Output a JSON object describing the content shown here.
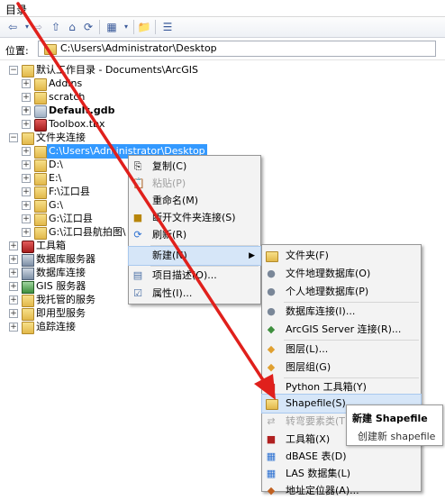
{
  "window": {
    "title": "目录"
  },
  "location": {
    "label": "位置:",
    "value": "C:\\Users\\Administrator\\Desktop"
  },
  "tree": {
    "home": "默认工作目录 - Documents\\ArcGIS",
    "addins": "AddIns",
    "scratch": "scratch",
    "default_gdb": "Default.gdb",
    "toolbox": "Toolbox.tbx",
    "folder_connections": "文件夹连接",
    "desktop": "C:\\Users\\Administrator\\Desktop",
    "d": "D:\\",
    "e": "E:\\",
    "f": "F:\\江口县",
    "g": "G:\\",
    "g_jk": "G:\\江口县",
    "g_jk_aerial": "G:\\江口县航拍图\\",
    "toolboxes": "工具箱",
    "db_servers": "数据库服务器",
    "db_connections": "数据库连接",
    "gis_servers": "GIS 服务器",
    "my_hosted": "我托管的服务",
    "ready_to_use": "即用型服务",
    "tracking": "追踪连接"
  },
  "context_menu": {
    "copy": "复制(C)",
    "paste": "粘贴(P)",
    "rename": "重命名(M)",
    "disconnect": "断开文件夹连接(S)",
    "refresh": "刷新(R)",
    "new": "新建(N)",
    "item_desc": "项目描述(O)...",
    "properties": "属性(I)..."
  },
  "submenu": {
    "folder": "文件夹(F)",
    "file_gdb": "文件地理数据库(O)",
    "personal_gdb": "个人地理数据库(P)",
    "db_conn": "数据库连接(I)...",
    "ags_conn": "ArcGIS Server 连接(R)...",
    "layer": "图层(L)...",
    "group_layer": "图层组(G)",
    "python_tbx": "Python 工具箱(Y)",
    "shapefile": "Shapefile(S)...",
    "turn_feature": "转弯要素类(T)",
    "toolbox": "工具箱(X)",
    "dbase": "dBASE 表(D)",
    "las": "LAS 数据集(L)",
    "address_locator": "地址定位器(A)..."
  },
  "tooltip": {
    "title": "新建 Shapefile",
    "desc": "创建新 shapefile"
  },
  "colors": {
    "selection": "#3399ff",
    "arrow": "#e0201c",
    "menu_highlight": "#d6e6f8"
  }
}
